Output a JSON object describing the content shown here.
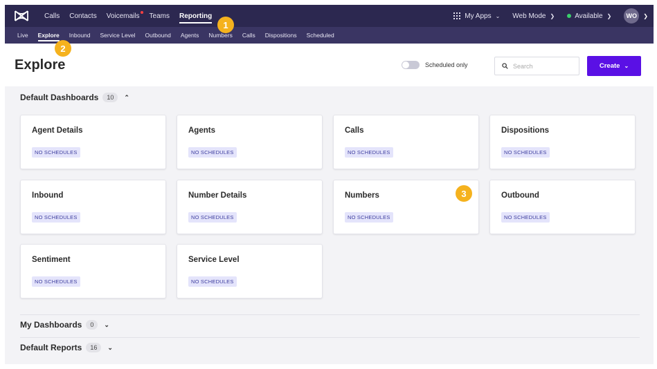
{
  "topnav": {
    "items": [
      {
        "label": "Calls"
      },
      {
        "label": "Contacts"
      },
      {
        "label": "Voicemails"
      },
      {
        "label": "Teams"
      },
      {
        "label": "Reporting"
      }
    ],
    "my_apps": "My Apps",
    "web_mode": "Web Mode",
    "status": "Available",
    "avatar": "WO"
  },
  "subnav": {
    "items": [
      {
        "label": "Live"
      },
      {
        "label": "Explore"
      },
      {
        "label": "Inbound"
      },
      {
        "label": "Service Level"
      },
      {
        "label": "Outbound"
      },
      {
        "label": "Agents"
      },
      {
        "label": "Numbers"
      },
      {
        "label": "Calls"
      },
      {
        "label": "Dispositions"
      },
      {
        "label": "Scheduled"
      }
    ]
  },
  "header": {
    "title": "Explore",
    "toggle_label": "Scheduled only",
    "search_placeholder": "Search",
    "create_label": "Create"
  },
  "sections": {
    "default_dashboards": {
      "label": "Default Dashboards",
      "count": "10"
    },
    "my_dashboards": {
      "label": "My Dashboards",
      "count": "0"
    },
    "default_reports": {
      "label": "Default Reports",
      "count": "16"
    }
  },
  "cards": [
    {
      "title": "Agent Details",
      "chip": "NO SCHEDULES"
    },
    {
      "title": "Agents",
      "chip": "NO SCHEDULES"
    },
    {
      "title": "Calls",
      "chip": "NO SCHEDULES"
    },
    {
      "title": "Dispositions",
      "chip": "NO SCHEDULES"
    },
    {
      "title": "Inbound",
      "chip": "NO SCHEDULES"
    },
    {
      "title": "Number Details",
      "chip": "NO SCHEDULES"
    },
    {
      "title": "Numbers",
      "chip": "NO SCHEDULES"
    },
    {
      "title": "Outbound",
      "chip": "NO SCHEDULES"
    },
    {
      "title": "Sentiment",
      "chip": "NO SCHEDULES"
    },
    {
      "title": "Service Level",
      "chip": "NO SCHEDULES"
    }
  ],
  "badges": [
    "1",
    "2",
    "3"
  ],
  "colors": {
    "accent": "#5a10e5",
    "nav_bg": "#2c2850",
    "subnav_bg": "#3a3563",
    "badge": "#f5b21e"
  }
}
